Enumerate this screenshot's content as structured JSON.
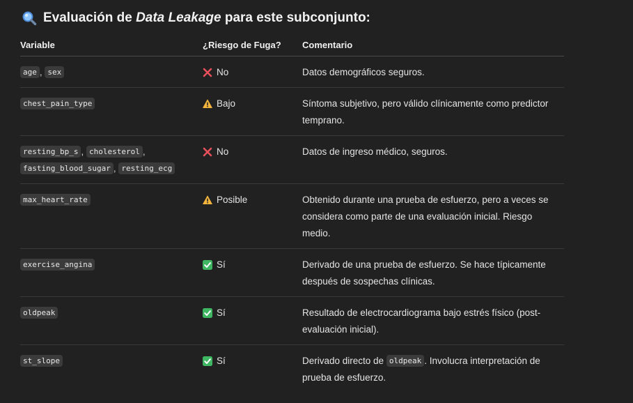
{
  "heading": {
    "prefix": "Evaluación de ",
    "emphasis": "Data Leakage",
    "suffix": " para este subconjunto:",
    "icon": "magnifying-glass-icon"
  },
  "table": {
    "headers": [
      "Variable",
      "¿Riesgo de Fuga?",
      "Comentario"
    ],
    "rows": [
      {
        "variables": [
          "age",
          "sex"
        ],
        "risk_icon": "cross-mark-icon",
        "risk": "No",
        "comment": "Datos demográficos seguros."
      },
      {
        "variables": [
          "chest_pain_type"
        ],
        "risk_icon": "warning-icon",
        "risk": "Bajo",
        "comment": "Síntoma subjetivo, pero válido clínicamente como predictor temprano."
      },
      {
        "variables": [
          "resting_bp_s",
          "cholesterol",
          "fasting_blood_sugar",
          "resting_ecg"
        ],
        "risk_icon": "cross-mark-icon",
        "risk": "No",
        "comment": "Datos de ingreso médico, seguros."
      },
      {
        "variables": [
          "max_heart_rate"
        ],
        "risk_icon": "warning-icon",
        "risk": "Posible",
        "comment": "Obtenido durante una prueba de esfuerzo, pero a veces se considera como parte de una evaluación inicial. Riesgo medio."
      },
      {
        "variables": [
          "exercise_angina"
        ],
        "risk_icon": "check-mark-icon",
        "risk": "Sí",
        "comment": "Derivado de una prueba de esfuerzo. Se hace típicamente después de sospechas clínicas."
      },
      {
        "variables": [
          "oldpeak"
        ],
        "risk_icon": "check-mark-icon",
        "risk": "Sí",
        "comment": "Resultado de electrocardiograma bajo estrés físico (post-evaluación inicial)."
      },
      {
        "variables": [
          "st_slope"
        ],
        "risk_icon": "check-mark-icon",
        "risk": "Sí",
        "comment_before": "Derivado directo de ",
        "comment_code": "oldpeak",
        "comment_after": ". Involucra interpretación de prueba de esfuerzo."
      }
    ]
  },
  "colors": {
    "background": "#212121",
    "code_background": "#3b3b3b",
    "cross_red": "#e8505b",
    "warning_amber": "#f3b43c",
    "check_green": "#3fb662"
  }
}
